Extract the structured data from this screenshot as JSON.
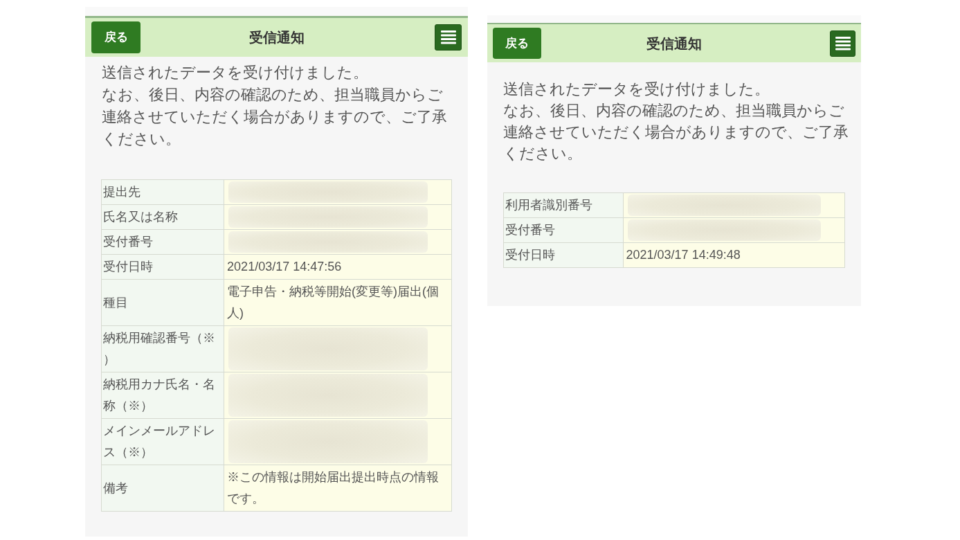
{
  "panels": [
    {
      "header": {
        "back_button": "戻る",
        "title": "受信通知"
      },
      "message": [
        "送信されたデータを受け付けました。",
        "なお、後日、内容の確認のため、担当職員からご連絡させていただく場合がありますので、ご了承ください。"
      ],
      "table": {
        "rows": [
          {
            "label": "提出先",
            "redacted": true
          },
          {
            "label": "氏名又は名称",
            "redacted": true
          },
          {
            "label": "受付番号",
            "redacted": true
          },
          {
            "label": "受付日時",
            "value": "2021/03/17 14:47:56",
            "redacted": false
          },
          {
            "label": "種目",
            "value": "電子申告・納税等開始(変更等)届出(個人)",
            "redacted": false
          },
          {
            "label": "納税用確認番号（※）",
            "redacted": true
          },
          {
            "label": "納税用カナ氏名・名称（※）",
            "redacted": true
          },
          {
            "label": "メインメールアドレス（※）",
            "redacted": true
          },
          {
            "label": "備考",
            "value": "※この情報は開始届出提出時点の情報です。",
            "redacted": false
          }
        ]
      }
    },
    {
      "header": {
        "back_button": "戻る",
        "title": "受信通知"
      },
      "message": [
        "送信されたデータを受け付けました。",
        "なお、後日、内容の確認のため、担当職員からご連絡させていただく場合がありますので、ご了承ください。"
      ],
      "table": {
        "rows": [
          {
            "label": "利用者識別番号",
            "redacted": true
          },
          {
            "label": "受付番号",
            "redacted": true
          },
          {
            "label": "受付日時",
            "value": "2021/03/17 14:49:48",
            "redacted": false
          }
        ]
      }
    }
  ]
}
